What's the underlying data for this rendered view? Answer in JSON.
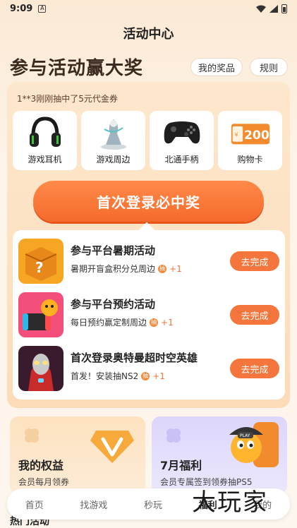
{
  "status": {
    "time": "9:09",
    "notif": "A"
  },
  "header": {
    "title": "活动中心"
  },
  "hero": {
    "title": "参与活动赢大奖",
    "my_prizes": "我的奖品",
    "rules": "规则"
  },
  "ticker": "1**3刚刚抽中了5元代金券",
  "prizes": [
    {
      "label": "游戏耳机",
      "icon": "headphones-icon"
    },
    {
      "label": "游戏周边",
      "icon": "figurine-icon"
    },
    {
      "label": "北通手柄",
      "icon": "gamepad-icon"
    },
    {
      "label": "购物卡",
      "icon": "gift-card-icon",
      "value": "200"
    }
  ],
  "cta": "首次登录必中奖",
  "tasks": [
    {
      "title": "参与平台暑期活动",
      "sub": "暑期开盲盒积分兑周边",
      "reward": "+1",
      "action": "去完成"
    },
    {
      "title": "参与平台预约活动",
      "sub": "每日预约赢定制周边",
      "reward": "+1",
      "action": "去完成"
    },
    {
      "title": "首次登录奥特曼超时空英雄",
      "sub": "首发！安装抽NS2",
      "reward": "+1",
      "action": "去完成"
    }
  ],
  "bottom_cards": [
    {
      "title": "我的权益",
      "sub": "会员每月领券"
    },
    {
      "title": "7月福利",
      "sub": "会员专属签到领券抽PS5"
    }
  ],
  "tabbar": [
    "首页",
    "找游戏",
    "秒玩",
    "福利",
    "我的"
  ],
  "active_tab": "福利",
  "watermark": "大玩家",
  "peek": "热门活动",
  "colors": {
    "accent": "#f4763c",
    "card_bg": "#fde7cd",
    "panel_bg": "#ffffff"
  }
}
